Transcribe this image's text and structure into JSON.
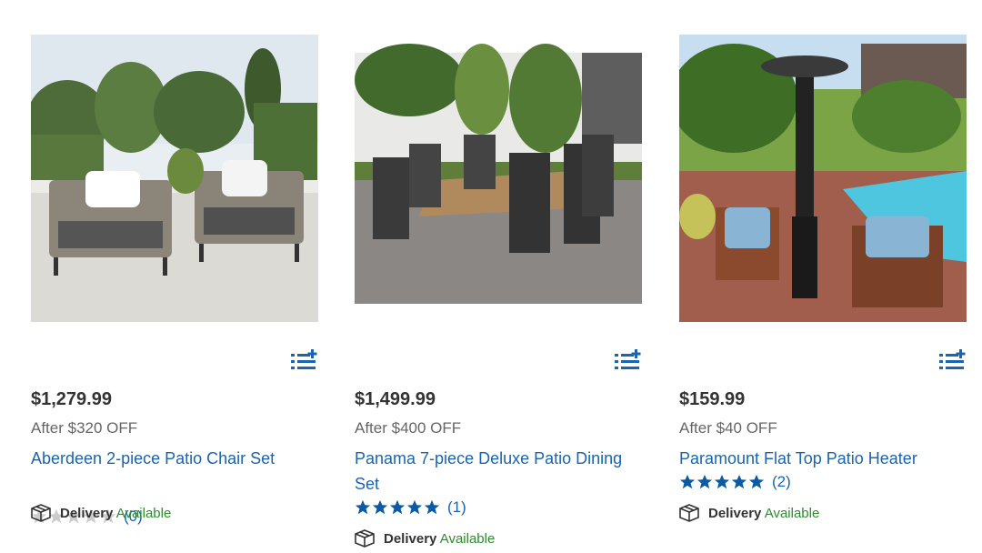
{
  "products": [
    {
      "price": "$1,279.99",
      "discount": "After $320 OFF",
      "title": "Aberdeen 2-piece Patio Chair Set",
      "rating_stars": 0,
      "review_count": "(0)",
      "delivery_label": "Delivery",
      "delivery_status": "Available"
    },
    {
      "price": "$1,499.99",
      "discount": "After $400 OFF",
      "title": "Panama 7-piece Deluxe Patio Dining Set",
      "rating_stars": 5,
      "review_count": "(1)",
      "delivery_label": "Delivery",
      "delivery_status": "Available"
    },
    {
      "price": "$159.99",
      "discount": "After $40 OFF",
      "title": "Paramount Flat Top Patio Heater",
      "rating_stars": 5,
      "review_count": "(2)",
      "delivery_label": "Delivery",
      "delivery_status": "Available"
    }
  ],
  "icons": {
    "list_add": "add-to-list-icon",
    "delivery": "box-icon",
    "star": "star-icon"
  },
  "colors": {
    "link": "#1a64b0",
    "available": "#2e8a2e",
    "star_filled": "#0b5aa6",
    "star_empty": "#cccccc"
  }
}
